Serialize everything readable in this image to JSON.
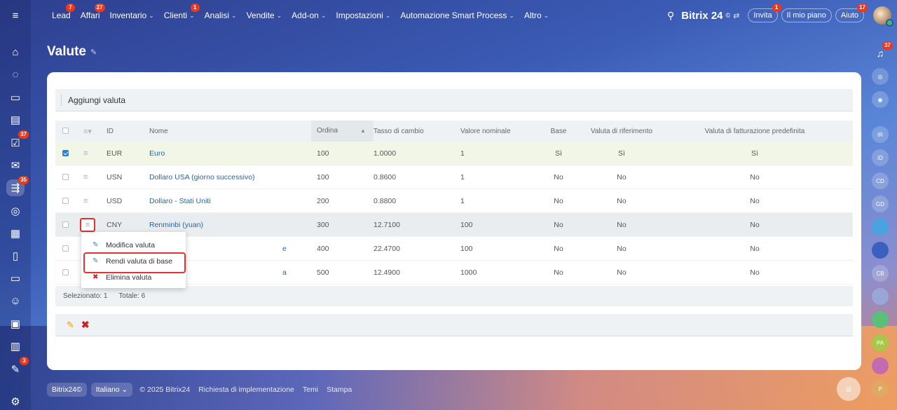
{
  "topnav": {
    "items": [
      {
        "label": "Lead",
        "badge": "7",
        "chevron": false
      },
      {
        "label": "Affari",
        "badge": "27",
        "chevron": false
      },
      {
        "label": "Inventario",
        "badge": "",
        "chevron": true
      },
      {
        "label": "Clienti",
        "badge": "1",
        "chevron": true
      },
      {
        "label": "Analisi",
        "badge": "",
        "chevron": true
      },
      {
        "label": "Vendite",
        "badge": "",
        "chevron": true
      },
      {
        "label": "Add-on",
        "badge": "",
        "chevron": true
      },
      {
        "label": "Impostazioni",
        "badge": "",
        "chevron": true
      },
      {
        "label": "Automazione Smart Process",
        "badge": "",
        "chevron": true
      },
      {
        "label": "Altro",
        "badge": "",
        "chevron": true
      }
    ],
    "brand": "Bitrix",
    "brand_num": "24",
    "brand_sup": "©",
    "invite_label": "Invita",
    "invite_badge": "1",
    "plan_label": "Il mio piano",
    "help_label": "Aiuto",
    "help_badge": "17"
  },
  "left_bar": {
    "badges": {
      "tasks": "37",
      "crm": "35",
      "automation": "3"
    }
  },
  "right_bar": {
    "notif_badge": "37",
    "items": [
      "IR",
      "ID",
      "CD",
      "GD",
      "",
      "",
      "CB",
      "",
      "",
      "PA",
      "",
      "P"
    ]
  },
  "page": {
    "title": "Valute"
  },
  "toolbar": {
    "add_label": "Aggiungi valuta"
  },
  "grid": {
    "headers": {
      "id": "ID",
      "name": "Nome",
      "order": "Ordina",
      "rate": "Tasso di cambio",
      "nominal": "Valore nominale",
      "base": "Base",
      "ref": "Valuta di riferimento",
      "default": "Valuta di fatturazione predefinita"
    },
    "rows": [
      {
        "id": "EUR",
        "name": "Euro",
        "order": "100",
        "rate": "1.0000",
        "nominal": "1",
        "base": "Sì",
        "ref": "Sì",
        "default": "Sì"
      },
      {
        "id": "USN",
        "name": "Dollaro USA (giorno successivo)",
        "order": "100",
        "rate": "0.8600",
        "nominal": "1",
        "base": "No",
        "ref": "No",
        "default": "No"
      },
      {
        "id": "USD",
        "name": "Dollaro - Stati Uniti",
        "order": "200",
        "rate": "0.8800",
        "nominal": "1",
        "base": "No",
        "ref": "No",
        "default": "No"
      },
      {
        "id": "CNY",
        "name": "Renminbi (yuan)",
        "order": "300",
        "rate": "12.7100",
        "nominal": "100",
        "base": "No",
        "ref": "No",
        "default": "No"
      },
      {
        "id": "",
        "name": "e",
        "order": "400",
        "rate": "22.4700",
        "nominal": "100",
        "base": "No",
        "ref": "No",
        "default": "No"
      },
      {
        "id": "",
        "name": "a",
        "order": "500",
        "rate": "12.4900",
        "nominal": "1000",
        "base": "No",
        "ref": "No",
        "default": "No"
      }
    ],
    "footer": {
      "selected": "Selezionato: 1",
      "total": "Totale: 6"
    }
  },
  "popup_menu": {
    "items": [
      "Modifica valuta",
      "Rendi valuta di base",
      "Elimina valuta"
    ]
  },
  "footer": {
    "brand": "Bitrix24",
    "brand_sup": "©",
    "language": "Italiano",
    "copyright": "© 2025 Bitrix24",
    "impl_link": "Richiesta di implementazione",
    "themes_link": "Temi",
    "print_link": "Stampa"
  },
  "colors": {
    "accent": "#2067b0",
    "highlight": "#e8312e",
    "badge": "#f0371b"
  }
}
